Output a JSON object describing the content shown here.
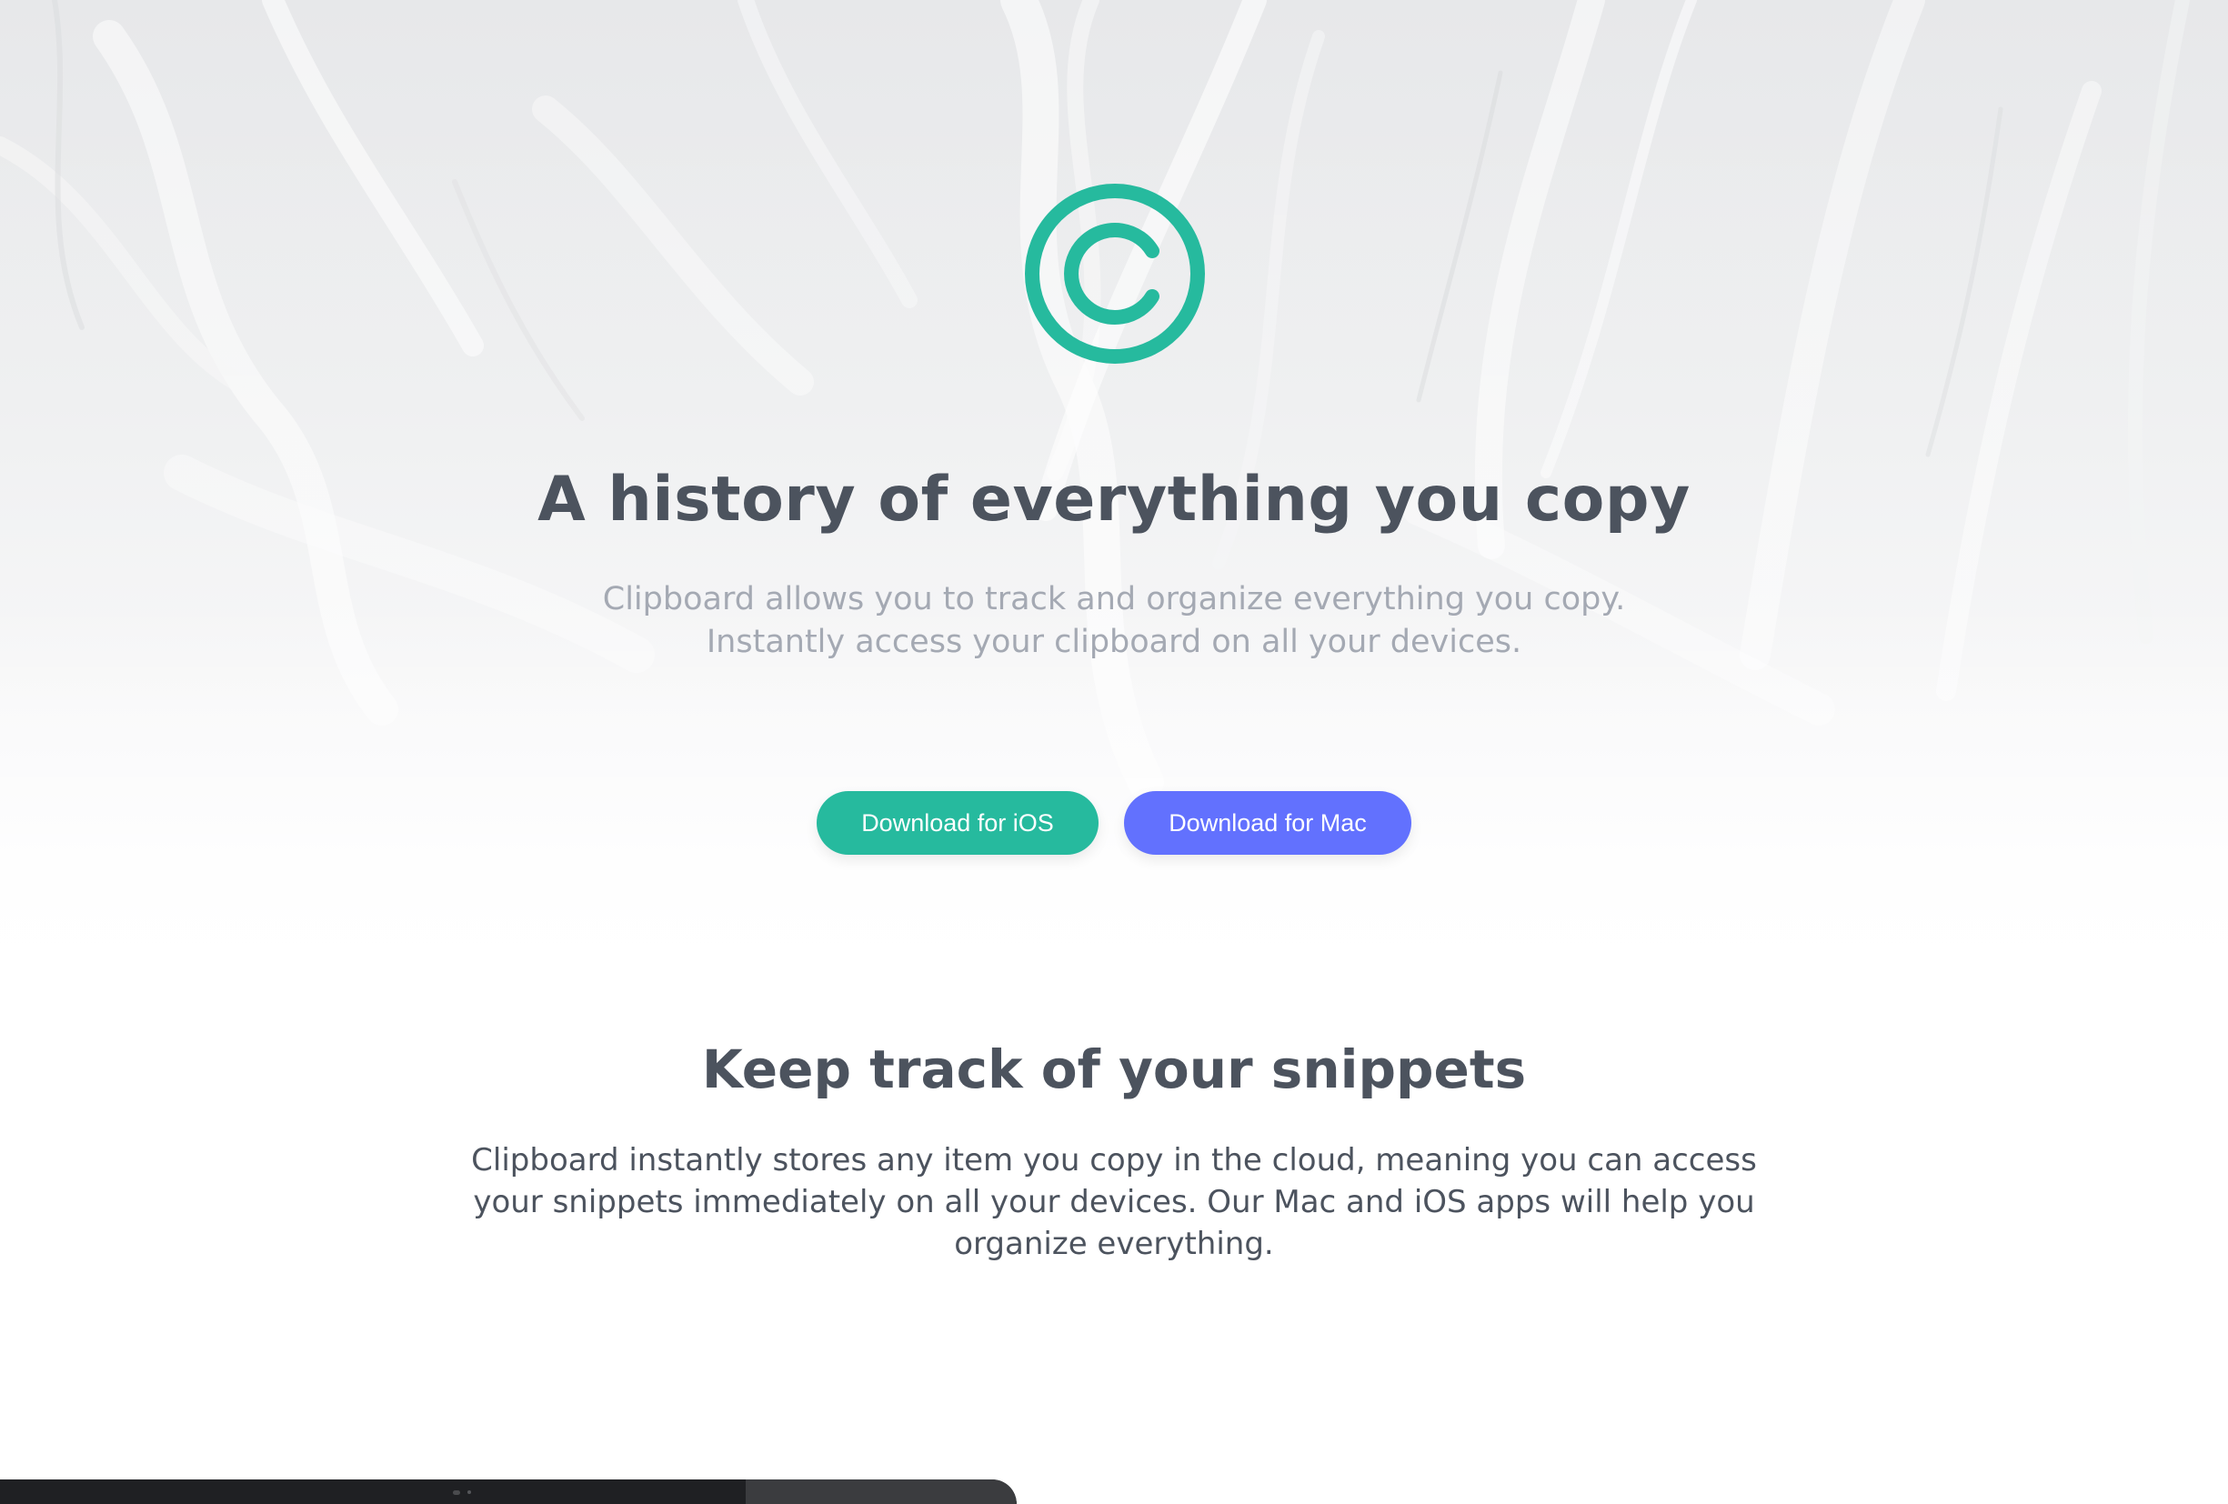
{
  "brand": {
    "logo_icon": "clipboard-c-icon",
    "accent_color": "#26ba9e",
    "secondary_color": "#6271fe"
  },
  "hero": {
    "title": "A history of everything you copy",
    "subtitle": "Clipboard allows you to track and organize everything you copy. Instantly access your clipboard on all your devices.",
    "buttons": {
      "ios": "Download for iOS",
      "mac": "Download for Mac"
    }
  },
  "snippets": {
    "title": "Keep track of your snippets",
    "body": "Clipboard instantly stores any item you copy in the cloud, meaning you can access your snippets immediately on all your devices. Our Mac and iOS apps will help you organize everything."
  }
}
